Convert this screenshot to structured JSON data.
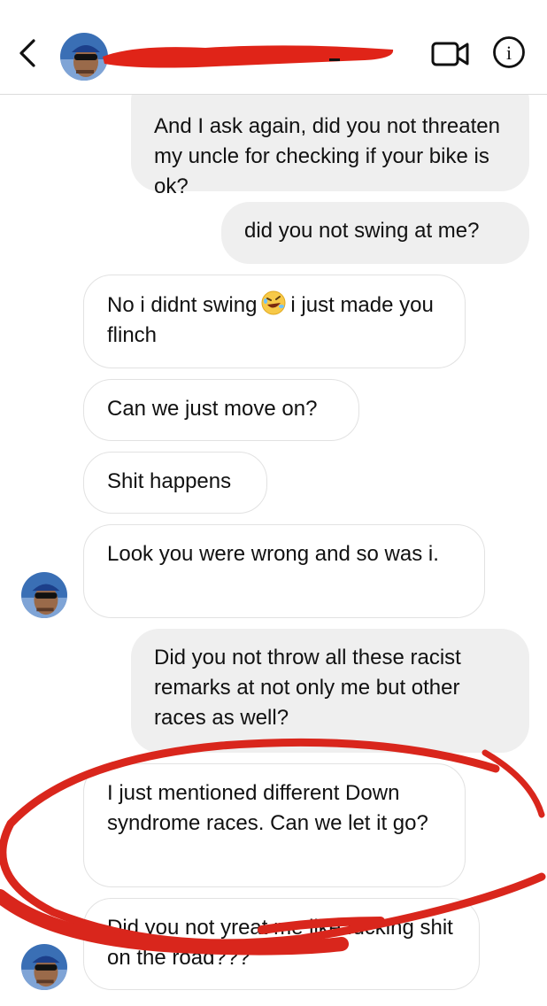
{
  "header": {
    "back_icon": "chevron-left-icon",
    "video_icon": "video-camera-icon",
    "info_icon": "info-icon",
    "info_glyph": "i"
  },
  "messages": [
    {
      "side": "sent",
      "text": "And I ask again, did you not threaten my uncle for checking if your bike is ok?"
    },
    {
      "side": "sent",
      "text": "did you not swing at me?"
    },
    {
      "side": "received",
      "text_before": "No i didnt swing",
      "emoji": "rolling-on-floor-laughing-emoji",
      "text_after": "i just made you flinch"
    },
    {
      "side": "received",
      "text": "Can we just move on?"
    },
    {
      "side": "received",
      "text": "Shit happens"
    },
    {
      "side": "received",
      "text": "Look you were wrong and so was i."
    },
    {
      "side": "sent",
      "text": "Did you not throw all these racist remarks at not only me but other races as well?"
    },
    {
      "side": "received",
      "text": "I just mentioned different Down syndrome races. Can we let it go?"
    },
    {
      "side": "received",
      "text": "Did you not yreat me like fucking shit on the road???"
    }
  ],
  "colors": {
    "sent_bubble": "#efefef",
    "received_border": "#e2e2e2",
    "annotation_red": "#d9261c"
  }
}
